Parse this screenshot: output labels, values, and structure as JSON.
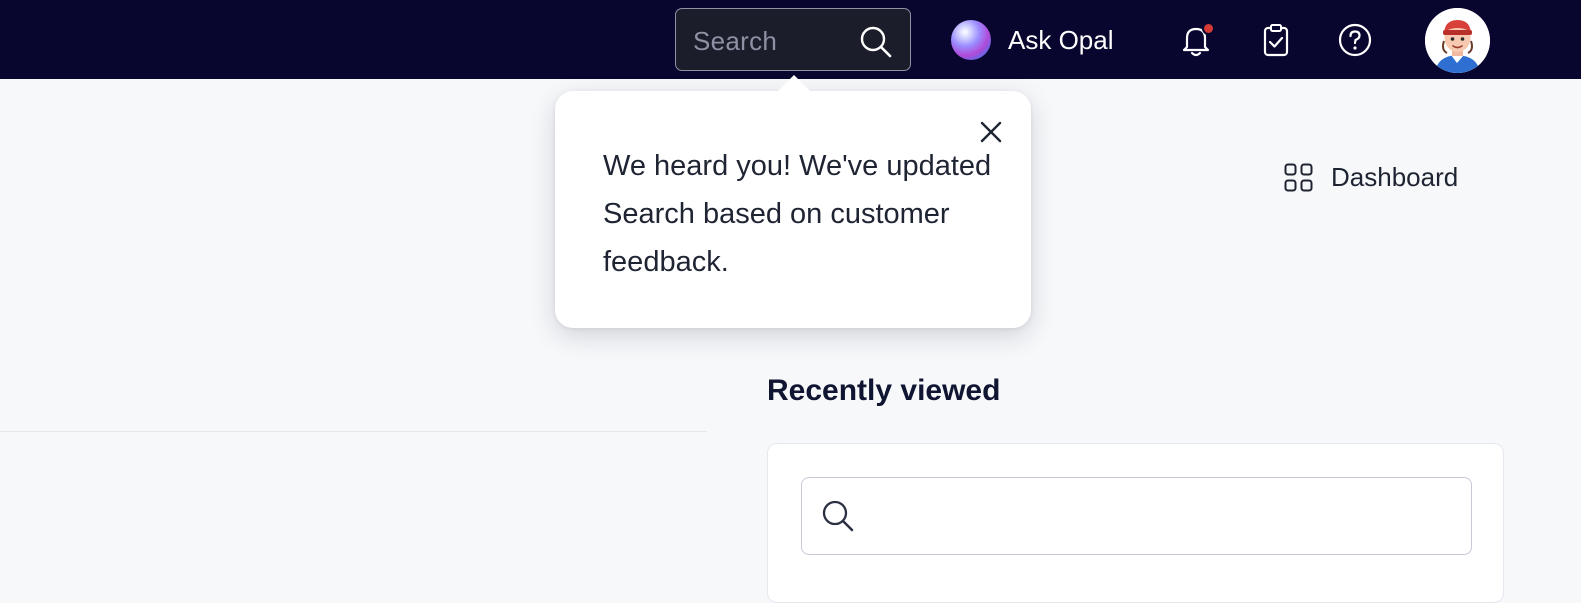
{
  "topbar": {
    "search": {
      "placeholder": "Search",
      "icon": "search-icon"
    },
    "ask_opal": {
      "label": "Ask Opal",
      "icon": "opal-orb-icon"
    },
    "icons": [
      "bell-icon",
      "clipboard-check-icon",
      "help-circle-icon"
    ],
    "notification_dot_color": "#d63a34",
    "background_color": "#08062f"
  },
  "popover": {
    "message": "We heard you! We've updated Search based on customer feedback.",
    "close_icon": "close-icon"
  },
  "main": {
    "dashboard_link": {
      "label": "Dashboard",
      "icon": "grid-icon"
    },
    "recently_viewed": {
      "title": "Recently viewed",
      "search_value": "",
      "search_icon": "search-icon"
    }
  }
}
